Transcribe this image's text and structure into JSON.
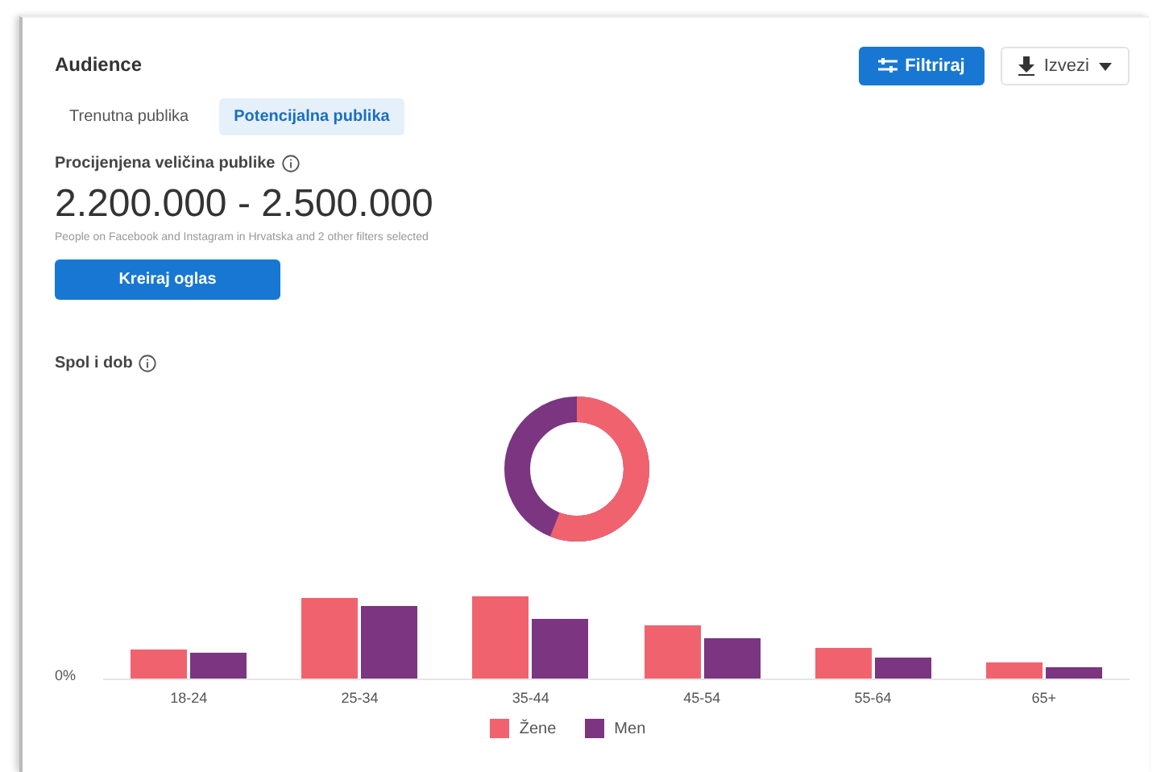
{
  "header": {
    "title": "Audience",
    "filter_button": "Filtriraj",
    "export_button": "Izvezi"
  },
  "tabs": [
    {
      "label": "Trenutna publika",
      "selected": false
    },
    {
      "label": "Potencijalna publika",
      "selected": true
    }
  ],
  "estimate": {
    "label": "Procijenjena veličina publike",
    "value": "2.200.000 - 2.500.000",
    "note": "People on Facebook and Instagram in Hrvatska and 2 other filters selected"
  },
  "create_button": "Kreiraj oglas",
  "gender_age": {
    "title": "Spol i dob",
    "axis_label": "0%",
    "categories": [
      "18-24",
      "25-34",
      "35-44",
      "45-54",
      "55-64",
      "65+"
    ],
    "legend": [
      {
        "label": "Žene",
        "color": "#f0636e"
      },
      {
        "label": "Men",
        "color": "#7b3581"
      }
    ]
  }
}
